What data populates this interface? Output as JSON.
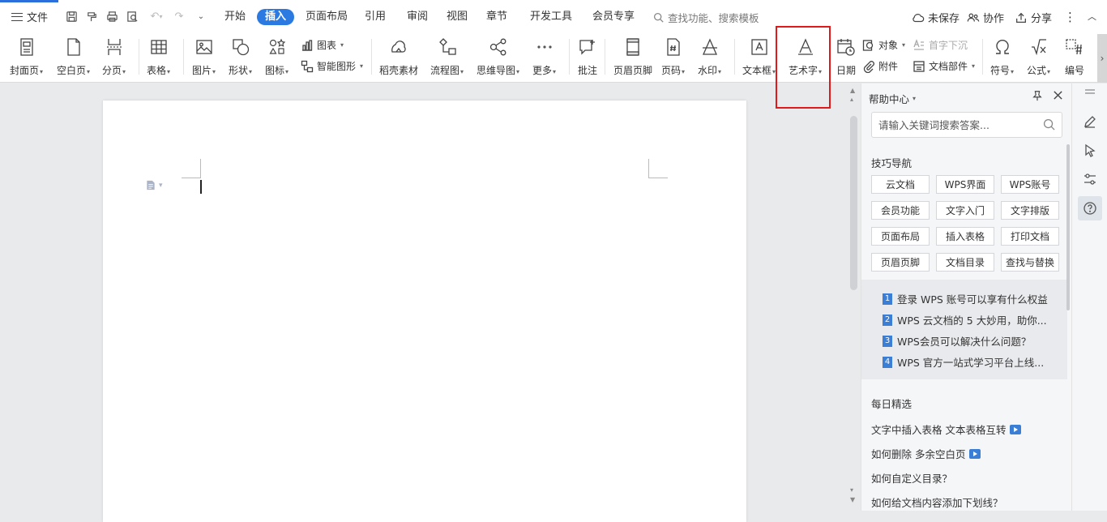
{
  "menubar": {
    "file_label": "文件",
    "tabs": [
      "开始",
      "插入",
      "页面布局",
      "引用",
      "审阅",
      "视图",
      "章节",
      "开发工具",
      "会员专享"
    ],
    "active_tab": "插入",
    "search_placeholder": "查找功能、搜索模板",
    "unsaved_label": "未保存",
    "collab_label": "协作",
    "share_label": "分享"
  },
  "ribbon": {
    "cover": "封面页",
    "blank": "空白页",
    "pagebreak": "分页",
    "table": "表格",
    "picture": "图片",
    "shape": "形状",
    "icon": "图标",
    "chart": "图表",
    "smartart": "智能图形",
    "material": "稻壳素材",
    "flowchart": "流程图",
    "mindmap": "思维导图",
    "more": "更多",
    "comment": "批注",
    "header_footer": "页眉页脚",
    "page_number": "页码",
    "watermark": "水印",
    "textbox": "文本框",
    "wordart": "艺术字",
    "date": "日期",
    "object": "对象",
    "dropcap": "首字下沉",
    "attachment": "附件",
    "doc_parts": "文档部件",
    "symbol": "符号",
    "formula": "公式",
    "numbering": "编号"
  },
  "help": {
    "title": "帮助中心",
    "search_placeholder": "请输入关键词搜索答案...",
    "tips_title": "技巧导航",
    "tips": [
      "云文档",
      "WPS界面",
      "WPS账号",
      "会员功能",
      "文字入门",
      "文字排版",
      "页面布局",
      "插入表格",
      "打印文档",
      "页眉页脚",
      "文档目录",
      "查找与替换"
    ],
    "faq": [
      {
        "num": "1",
        "text": "登录 WPS 账号可以享有什么权益"
      },
      {
        "num": "2",
        "text": "WPS 云文档的 5 大妙用，助你..."
      },
      {
        "num": "3",
        "text": "WPS会员可以解决什么问题？"
      },
      {
        "num": "4",
        "text": "WPS 官方一站式学习平台上线..."
      }
    ],
    "daily_title": "每日精选",
    "daily": [
      "文字中插入表格 文本表格互转",
      "如何删除 多余空白页",
      "如何自定义目录？",
      "如何给文档内容添加下划线？"
    ]
  },
  "colors": {
    "accent": "#2a7ae2",
    "highlight": "#e0191b"
  }
}
